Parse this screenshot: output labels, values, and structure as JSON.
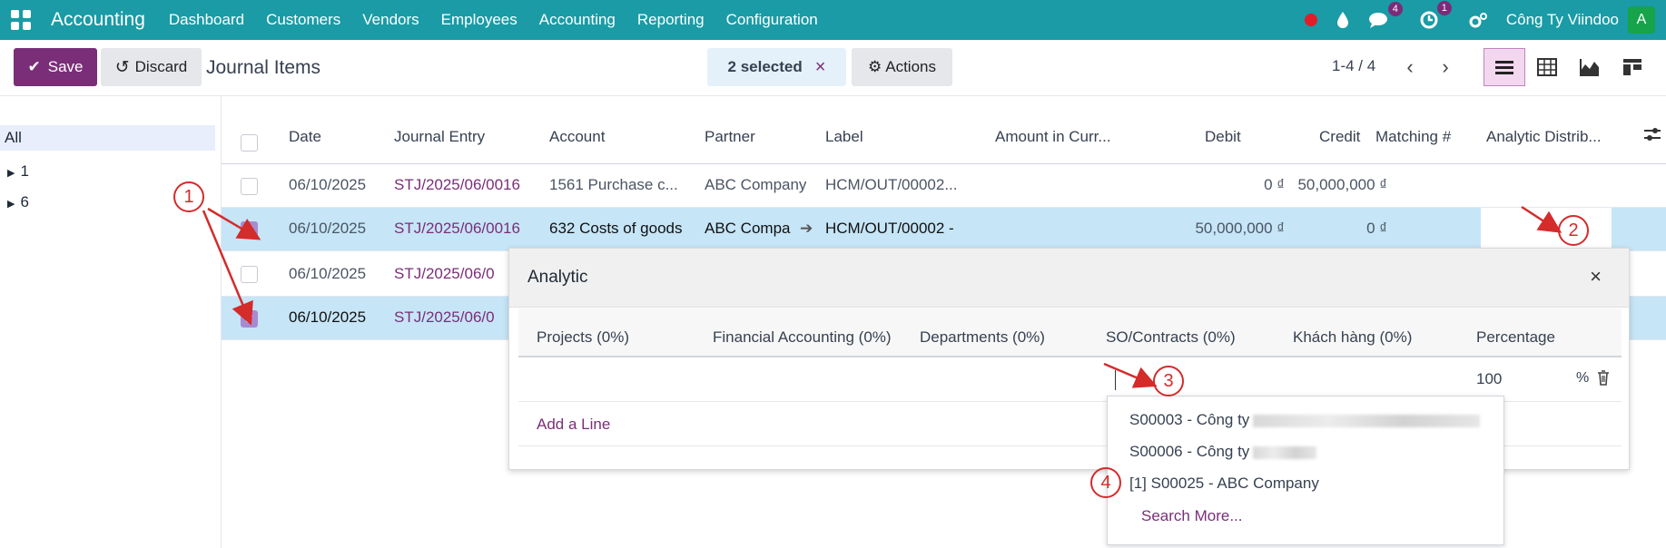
{
  "topbar": {
    "brand": "Accounting",
    "menu": [
      "Dashboard",
      "Customers",
      "Vendors",
      "Employees",
      "Accounting",
      "Reporting",
      "Configuration"
    ],
    "chat_badge": "4",
    "activity_badge": "1",
    "company": "Công Ty Viindoo",
    "avatar_letter": "A"
  },
  "controls": {
    "save_label": "Save",
    "discard_label": "Discard",
    "page_title": "Journal Items",
    "selected_text": "2 selected",
    "selected_clear": "×",
    "actions_label": "Actions",
    "pager_text": "1-4 / 4"
  },
  "sidebar": {
    "all_label": "All",
    "groups": [
      "1",
      "6"
    ]
  },
  "table": {
    "columns": [
      "Date",
      "Journal Entry",
      "Account",
      "Partner",
      "Label",
      "Amount in Curr...",
      "Debit",
      "Credit",
      "Matching #",
      "Analytic Distrib..."
    ],
    "rows": [
      {
        "date": "06/10/2025",
        "entry": "STJ/2025/06/0016",
        "account": "1561 Purchase c...",
        "partner": "ABC Company",
        "label": "HCM/OUT/00002...",
        "debit": "0 ₫",
        "credit": "50,000,000 ₫"
      },
      {
        "date": "06/10/2025",
        "entry": "STJ/2025/06/0016",
        "account": "632 Costs of goods",
        "partner": "ABC Compa",
        "label": "HCM/OUT/00002 -",
        "debit": "50,000,000 ₫",
        "credit": "0 ₫"
      },
      {
        "date": "06/10/2025",
        "entry": "STJ/2025/06/0"
      },
      {
        "date": "06/10/2025",
        "entry": "STJ/2025/06/0"
      }
    ]
  },
  "analytic_popup": {
    "title": "Analytic",
    "close": "×",
    "columns": [
      "Projects (0%)",
      "Financial Accounting (0%)",
      "Departments (0%)",
      "SO/Contracts (0%)",
      "Khách hàng (0%)",
      "Percentage"
    ],
    "line_percentage": "100",
    "percent_sign": "%",
    "add_line": "Add a Line"
  },
  "dropdown": {
    "items": [
      "S00003 - Công ty",
      "S00006 - Công ty",
      "[1] S00025 - ABC Company"
    ],
    "search_more": "Search More..."
  },
  "annotations": [
    "1",
    "2",
    "3",
    "4"
  ],
  "colors": {
    "topbar": "#1a9ba6",
    "primary": "#7a2e78",
    "annotation": "#d42b2b",
    "selected_row": "#c6e5f7"
  }
}
